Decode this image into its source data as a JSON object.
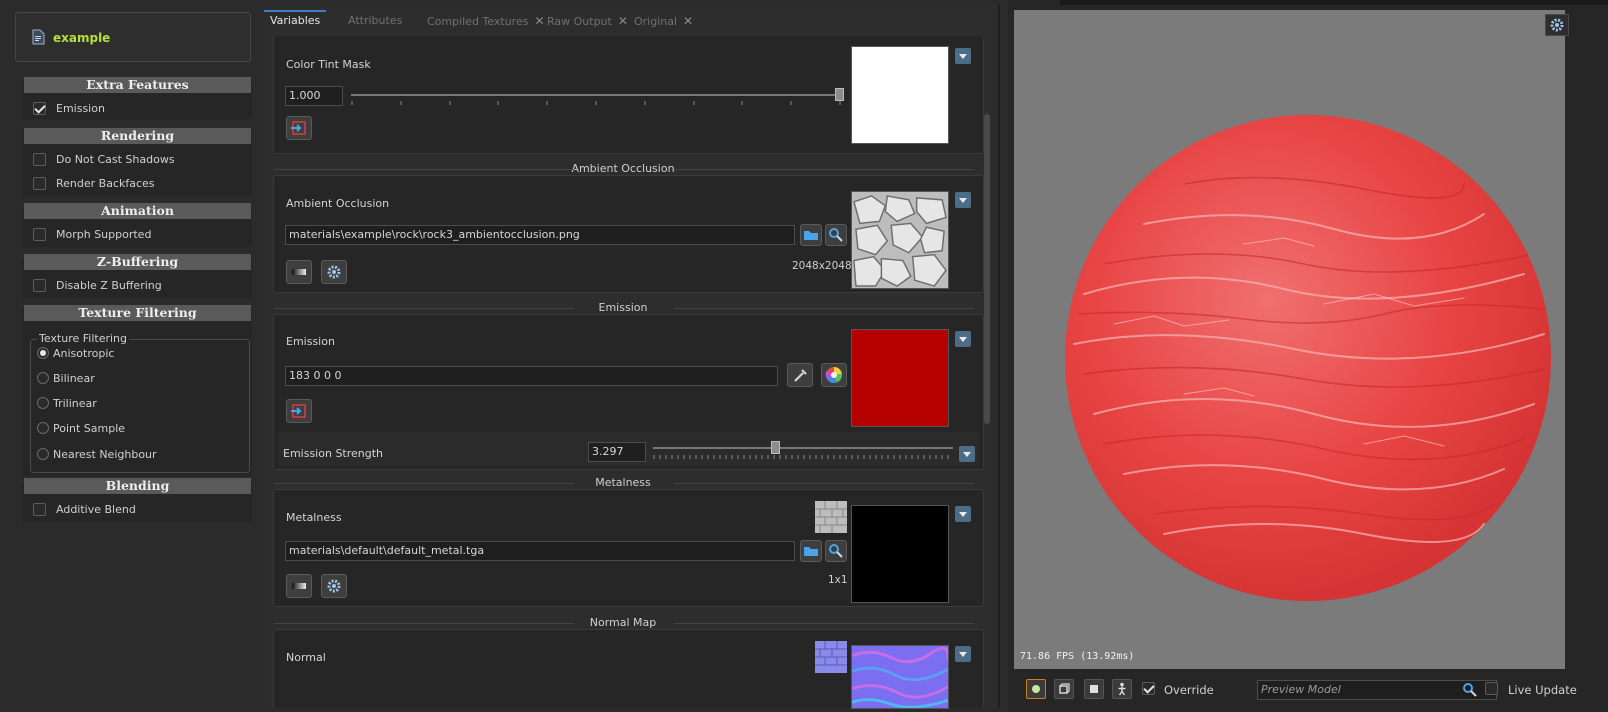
{
  "material": {
    "name": "example",
    "icon": "file-icon"
  },
  "sections": {
    "extra_features": {
      "title": "Extra Features",
      "items": [
        {
          "label": "Emission",
          "checked": true
        }
      ]
    },
    "rendering": {
      "title": "Rendering",
      "items": [
        {
          "label": "Do Not Cast Shadows",
          "checked": false
        },
        {
          "label": "Render Backfaces",
          "checked": false
        }
      ]
    },
    "animation": {
      "title": "Animation",
      "items": [
        {
          "label": "Morph Supported",
          "checked": false
        }
      ]
    },
    "zbuffering": {
      "title": "Z-Buffering",
      "items": [
        {
          "label": "Disable Z Buffering",
          "checked": false
        }
      ]
    },
    "texture_filtering": {
      "title": "Texture Filtering",
      "group_label": "Texture Filtering",
      "options": [
        "Anisotropic",
        "Bilinear",
        "Trilinear",
        "Point Sample",
        "Nearest Neighbour"
      ],
      "selected": "Anisotropic"
    },
    "blending": {
      "title": "Blending",
      "items": [
        {
          "label": "Additive Blend",
          "checked": false
        }
      ]
    }
  },
  "tabs": [
    {
      "label": "Variables",
      "active": true,
      "closable": false
    },
    {
      "label": "Attributes",
      "active": false,
      "closable": false
    },
    {
      "label": "Compiled Textures",
      "active": false,
      "closable": true
    },
    {
      "label": "Raw Output",
      "active": false,
      "closable": true
    },
    {
      "label": "Original",
      "active": false,
      "closable": true
    }
  ],
  "variables": {
    "color_tint_mask": {
      "label": "Color Tint Mask",
      "value": "1.000",
      "slider_fraction": 1.0,
      "swatch_color": "#ffffff"
    },
    "ambient_occlusion": {
      "group": "Ambient Occlusion",
      "label": "Ambient Occlusion",
      "path": "materials\\example\\rock\\rock3_ambientocclusion.png",
      "resolution": "2048x2048"
    },
    "emission": {
      "group": "Emission",
      "label": "Emission",
      "value": "183 0 0 0",
      "swatch_color": "#b70000"
    },
    "emission_strength": {
      "label": "Emission Strength",
      "value": "3.297",
      "slider_fraction": 0.41
    },
    "metalness": {
      "group": "Metalness",
      "label": "Metalness",
      "path": "materials\\default\\default_metal.tga",
      "resolution": "1x1",
      "swatch_color": "#000000"
    },
    "normal_map": {
      "group": "Normal Map",
      "label": "Normal"
    }
  },
  "viewport": {
    "fps_text": "71.86 FPS (13.92ms)",
    "background": "#7b7b7b",
    "sphere_color": "#e83a3a",
    "override_label": "Override",
    "override_checked": true,
    "preview_placeholder": "Preview Model",
    "live_update_label": "Live Update",
    "live_update_checked": false
  },
  "colors": {
    "accent": "#3a7fc1",
    "material_name": "#b5e13b",
    "dropdown": "#4d6d86"
  }
}
